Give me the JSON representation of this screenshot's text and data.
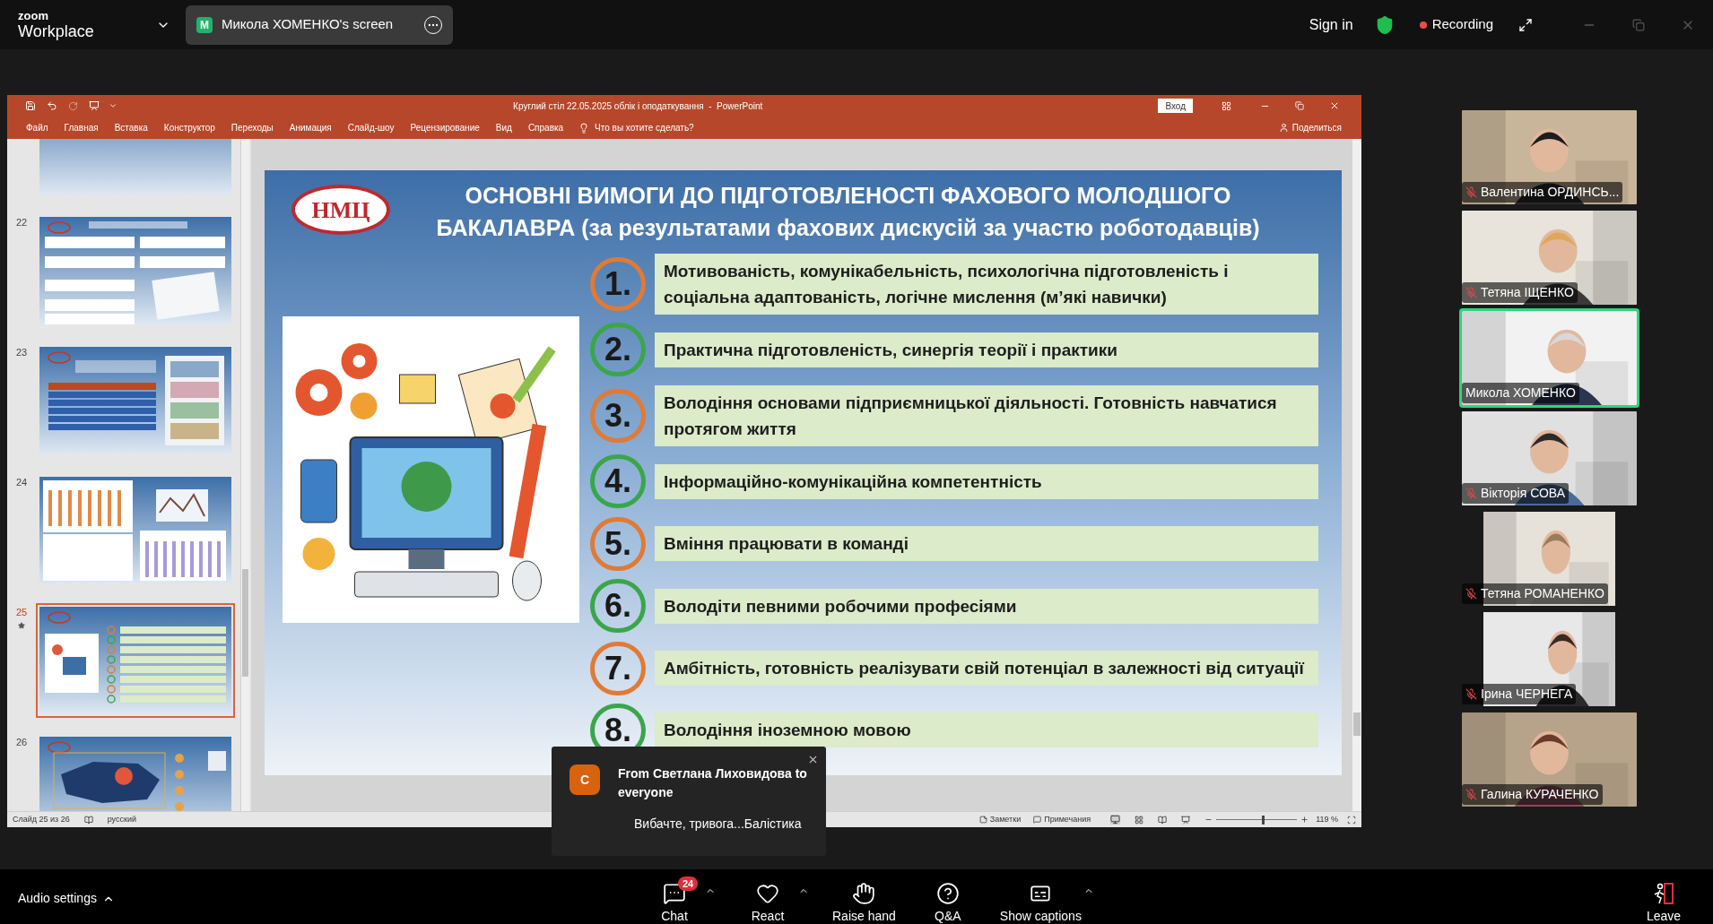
{
  "zoom_bar": {
    "logo_top": "zoom",
    "logo_bottom": "Workplace",
    "share_tab": {
      "avatar": "M",
      "label": "Микола ХОМЕНКО's screen"
    },
    "sign_in": "Sign in",
    "recording": "Recording"
  },
  "powerpoint": {
    "title": "Круглий стіл 22.05.2025 облік і оподаткування  -  PowerPoint",
    "sign_in": "Вход",
    "ribbon_tabs": [
      "Файл",
      "Главная",
      "Вставка",
      "Конструктор",
      "Переходы",
      "Анимация",
      "Слайд-шоу",
      "Рецензирование",
      "Вид",
      "Справка"
    ],
    "tell_me": "Что вы хотите сделать?",
    "share": "Поделиться",
    "thumbnails": [
      {
        "selected": false,
        "starred": false,
        "kind": "list"
      },
      {
        "number": "22",
        "selected": false,
        "starred": false,
        "kind": "boxes"
      },
      {
        "number": "23",
        "selected": false,
        "starred": false,
        "kind": "table"
      },
      {
        "number": "24",
        "selected": false,
        "starred": false,
        "kind": "charts"
      },
      {
        "number": "25",
        "selected": true,
        "starred": true,
        "kind": "current"
      },
      {
        "number": "26",
        "selected": false,
        "starred": false,
        "kind": "map"
      }
    ],
    "slide": {
      "logo": "НМЦ",
      "title_lines": [
        "ОСНОВНІ ВИМОГИ ДО ПІДГОТОВЛЕНОСТІ ФАХОВОГО МОЛОДШОГО",
        "БАКАЛАВРА (за результатами фахових дискусій за участю роботодавців)"
      ],
      "items": [
        {
          "number": "1.",
          "text": "Мотивованість, комунікабельність, психологічна підготовленість і соціальна адаптованість, логічне мислення (м’які навички)",
          "color": "#e07a35"
        },
        {
          "number": "2.",
          "text": "Практична підготовленість, синергія теорії і практики",
          "color": "#3aa64a"
        },
        {
          "number": "3.",
          "text": "Володіння основами підприємницької діяльності. Готовність навчатися протягом життя",
          "color": "#e07a35"
        },
        {
          "number": "4.",
          "text": "Інформаційно-комунікаційна компетентність",
          "color": "#3aa64a"
        },
        {
          "number": "5.",
          "text": "Вміння працювати в команді",
          "color": "#e07a35"
        },
        {
          "number": "6.",
          "text": "Володіти певними робочими професіями",
          "color": "#3aa64a"
        },
        {
          "number": "7.",
          "text": "Амбітність, готовність реалізувати свій потенціал в залежності від ситуації",
          "color": "#e07a35"
        },
        {
          "number": "8.",
          "text": "Володіння іноземною мовою",
          "color": "#3aa64a"
        }
      ]
    },
    "status_bar": {
      "slide_position": "Слайд 25 из 26",
      "language": "русский",
      "notes": "Заметки",
      "comments": "Примечания",
      "zoom": "119 %",
      "zoom_slider": {
        "level": 0.58
      }
    }
  },
  "participants": [
    {
      "name": "Валентина ОРДИНСЬ...",
      "muted": true,
      "speaking": false
    },
    {
      "name": "Тетяна ІЩЕНКО",
      "muted": true,
      "speaking": false
    },
    {
      "name": "Микола ХОМЕНКО",
      "muted": false,
      "speaking": true
    },
    {
      "name": "Вікторія СОВА",
      "muted": true,
      "speaking": false
    },
    {
      "name": "Тетяна РОМАНЕНКО",
      "muted": true,
      "speaking": false
    },
    {
      "name": "Ірина ЧЕРНЕГА",
      "muted": true,
      "speaking": false
    },
    {
      "name": "Галина КУРАЧЕНКО",
      "muted": true,
      "speaking": false
    }
  ],
  "chat_toast": {
    "initial": "C",
    "from": "From Светлана Лиховидова to everyone",
    "message": "Вибачте, тривога...Балістика"
  },
  "toolbar": {
    "audio": "Audio settings",
    "buttons": [
      {
        "kind": "chat",
        "label": "Chat",
        "badge": "24",
        "has_menu": true
      },
      {
        "kind": "react",
        "label": "React",
        "has_menu": true
      },
      {
        "kind": "hand",
        "label": "Raise hand",
        "has_menu": false
      },
      {
        "kind": "qa",
        "label": "Q&A",
        "has_menu": false
      },
      {
        "kind": "captions",
        "label": "Show captions",
        "has_menu": true
      }
    ],
    "leave": "Leave"
  }
}
